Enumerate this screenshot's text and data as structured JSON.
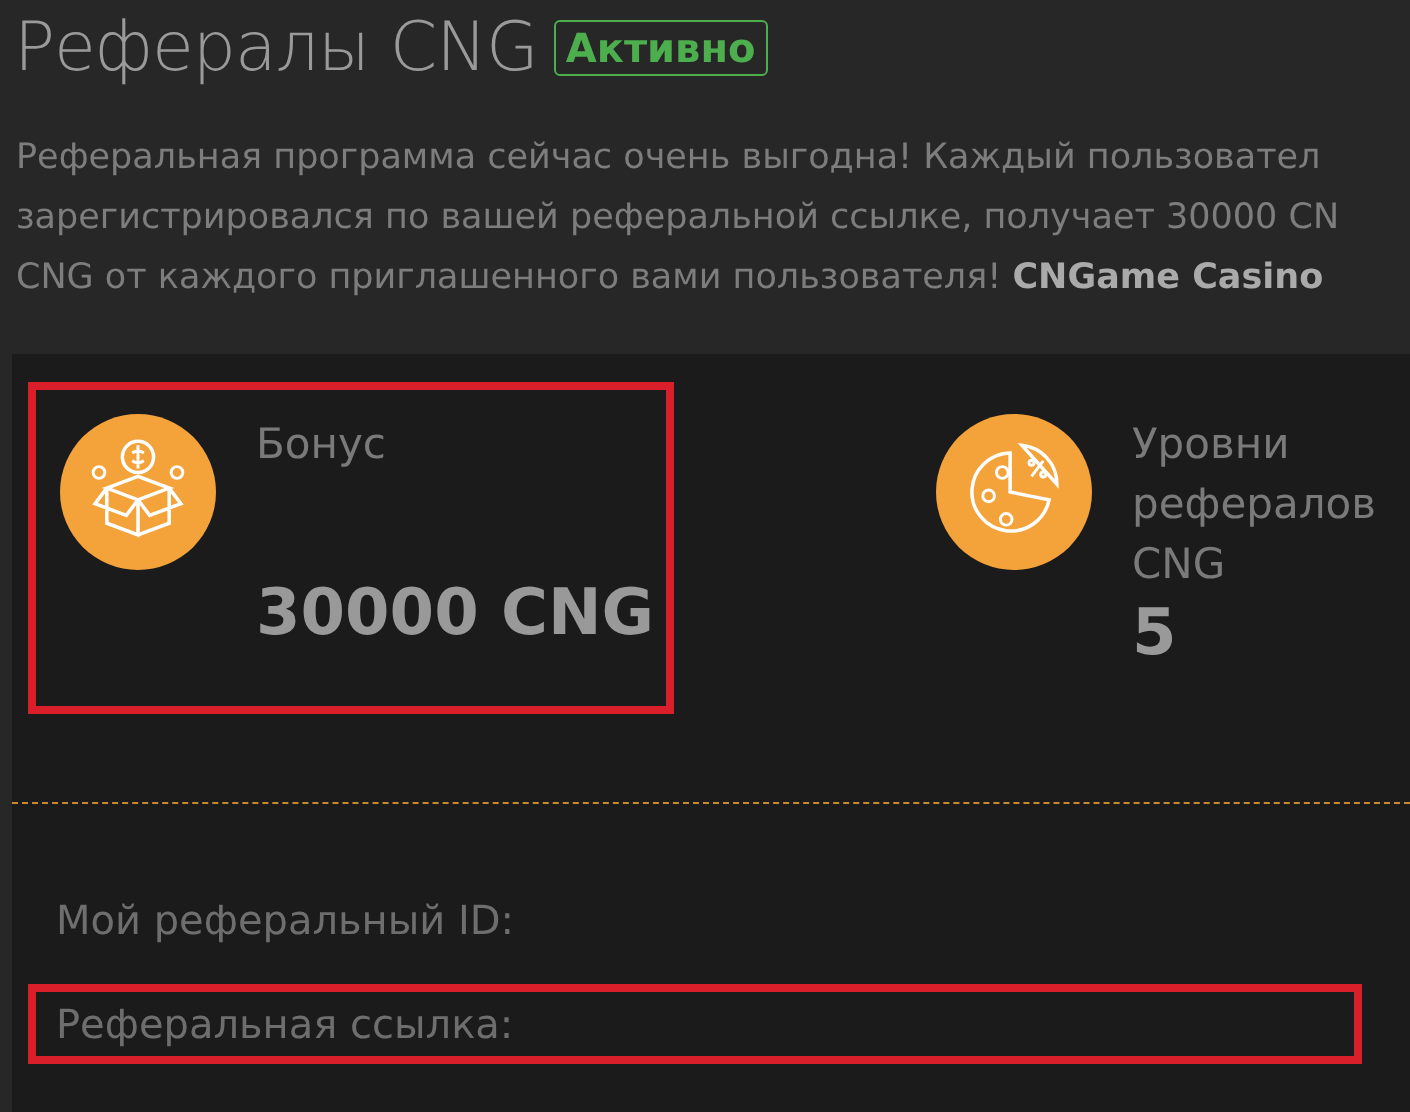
{
  "header": {
    "title": "Рефералы CNG",
    "status_badge": "Активно",
    "active": true
  },
  "description": [
    "Реферальная программа сейчас очень выгодна! Каждый пользовател",
    "зарегистрировался по вашей реферальной ссылке, получает 30000 CN",
    "CNG от каждого приглашенного вами пользователя! **CNGame Casino**"
  ],
  "stats": [
    {
      "kind": "bonus",
      "label": "Бонус",
      "value": "30000 CNG",
      "highlighted": true
    },
    {
      "kind": "levels",
      "label": "Уровни рефералов CNG",
      "value": "5",
      "highlighted": false
    }
  ],
  "fields": [
    {
      "label": "Мой реферальный ID:",
      "highlighted": false
    },
    {
      "label": "Реферальная ссылка:",
      "highlighted": true
    }
  ]
}
